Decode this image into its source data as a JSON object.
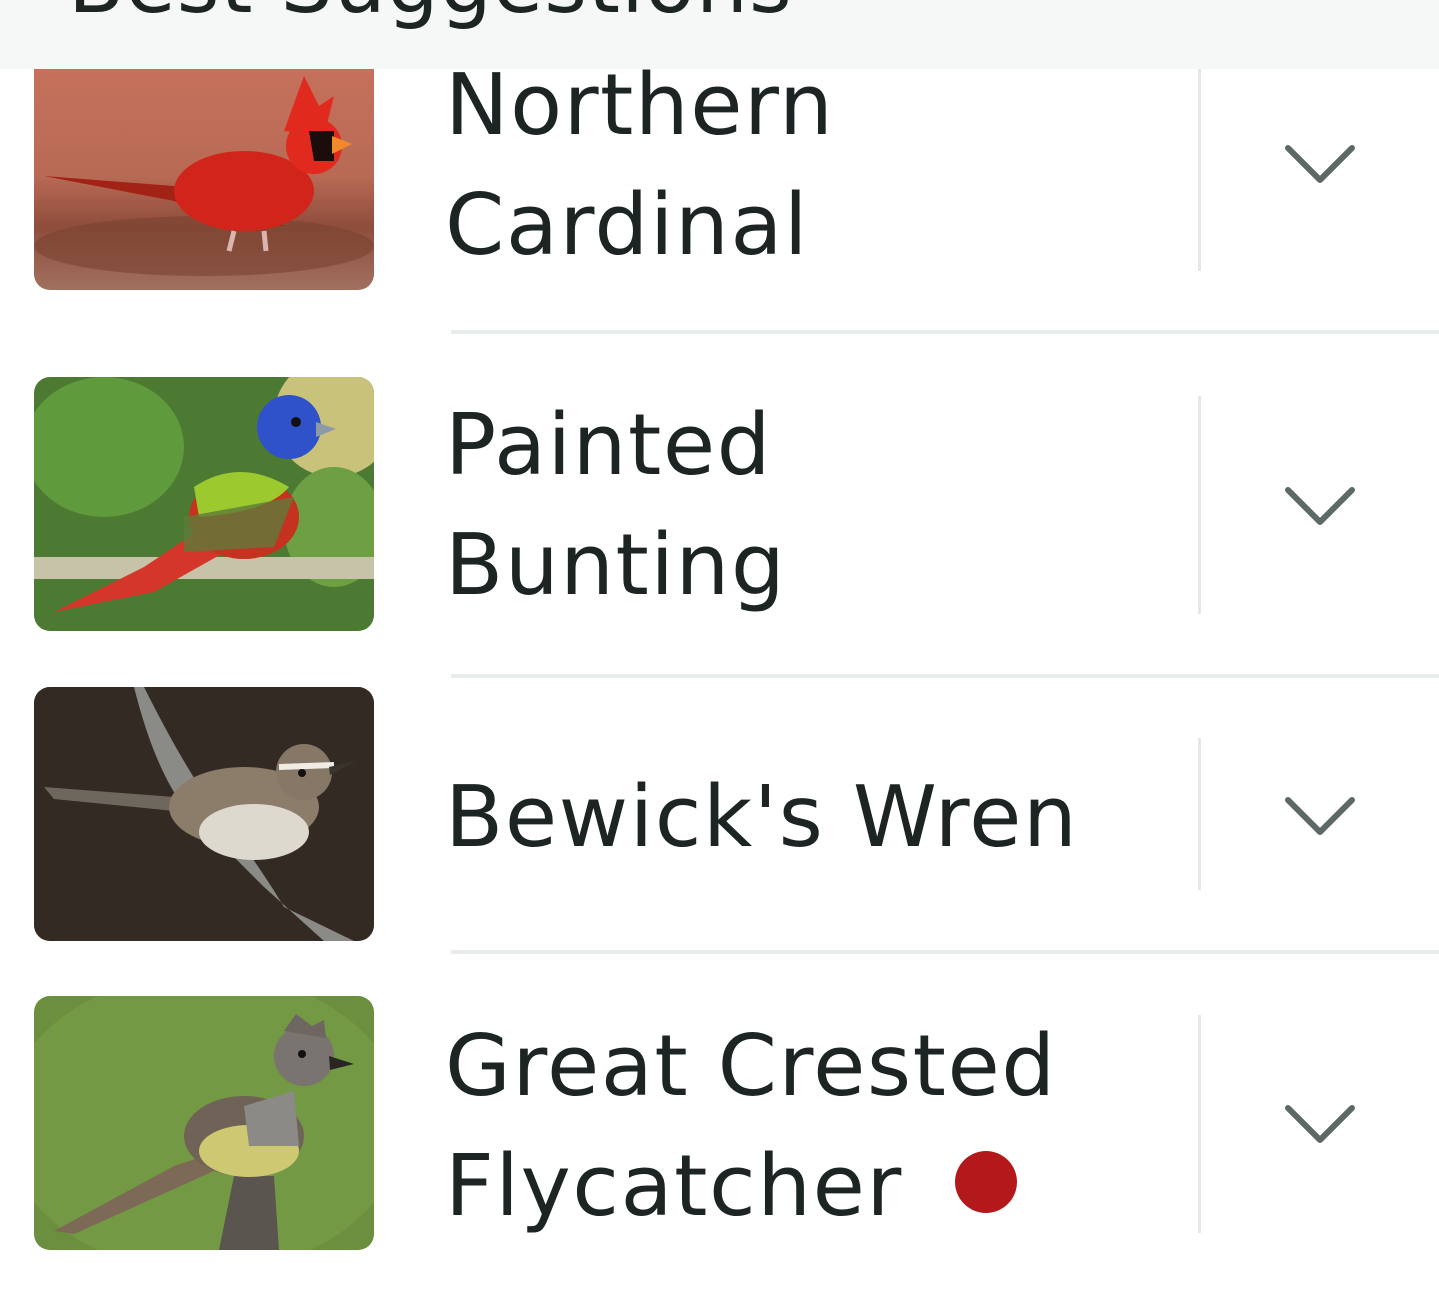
{
  "section_header": {
    "label": "Best Suggestions"
  },
  "suggestions": [
    {
      "name_line1": "Northern",
      "name_line2": "Cardinal",
      "photo": "northern-cardinal-photo",
      "expand_icon": "chevron-down-icon"
    },
    {
      "name_line1": "Painted",
      "name_line2": "Bunting",
      "photo": "painted-bunting-photo",
      "expand_icon": "chevron-down-icon"
    },
    {
      "name_line1": "Bewick's Wren",
      "photo": "bewicks-wren-photo",
      "expand_icon": "chevron-down-icon"
    },
    {
      "name_line1": "Great Crested",
      "name_line2": "Flycatcher",
      "photo": "great-crested-flycatcher-photo",
      "expand_icon": "chevron-down-icon",
      "badge": "status-dot",
      "badge_color": "#b3191b"
    }
  ],
  "colors": {
    "text": "#1c2524",
    "chevron": "#5d6967",
    "divider": "#e8eceb",
    "header_bg": "#f6f8f7",
    "accent_dot": "#b3191b"
  }
}
